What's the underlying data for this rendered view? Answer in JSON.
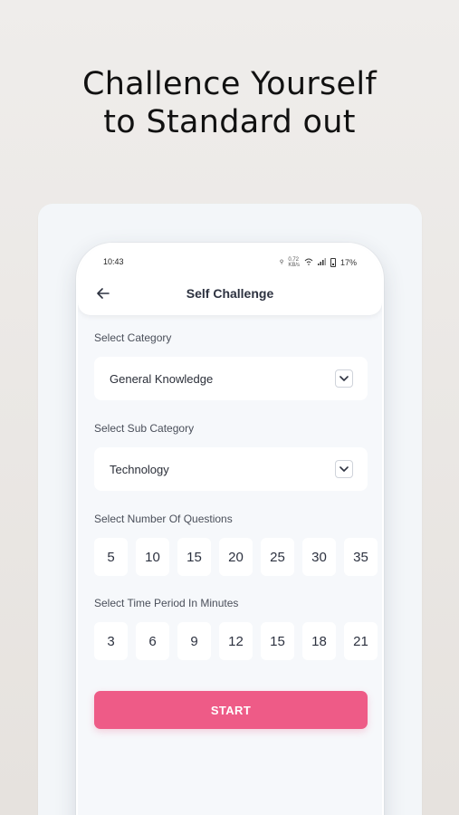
{
  "headline": {
    "line1": "Challence Yourself",
    "line2": "to Standard out"
  },
  "status_bar": {
    "time": "10:43",
    "network_small": "0.72\nKB/s",
    "battery": "17%"
  },
  "app_bar": {
    "title": "Self Challenge",
    "back_icon": "arrow-left-icon"
  },
  "category": {
    "label": "Select Category",
    "value": "General Knowledge"
  },
  "sub_category": {
    "label": "Select Sub Category",
    "value": "Technology"
  },
  "questions": {
    "label": "Select Number Of Questions",
    "options": [
      "5",
      "10",
      "15",
      "20",
      "25",
      "30",
      "35"
    ]
  },
  "time_period": {
    "label": "Select Time Period In Minutes",
    "options": [
      "3",
      "6",
      "9",
      "12",
      "15",
      "18",
      "21"
    ]
  },
  "start_button": {
    "label": "START"
  },
  "colors": {
    "accent": "#ee5b87",
    "background": "#f6f8fb",
    "text": "#2d3240"
  }
}
